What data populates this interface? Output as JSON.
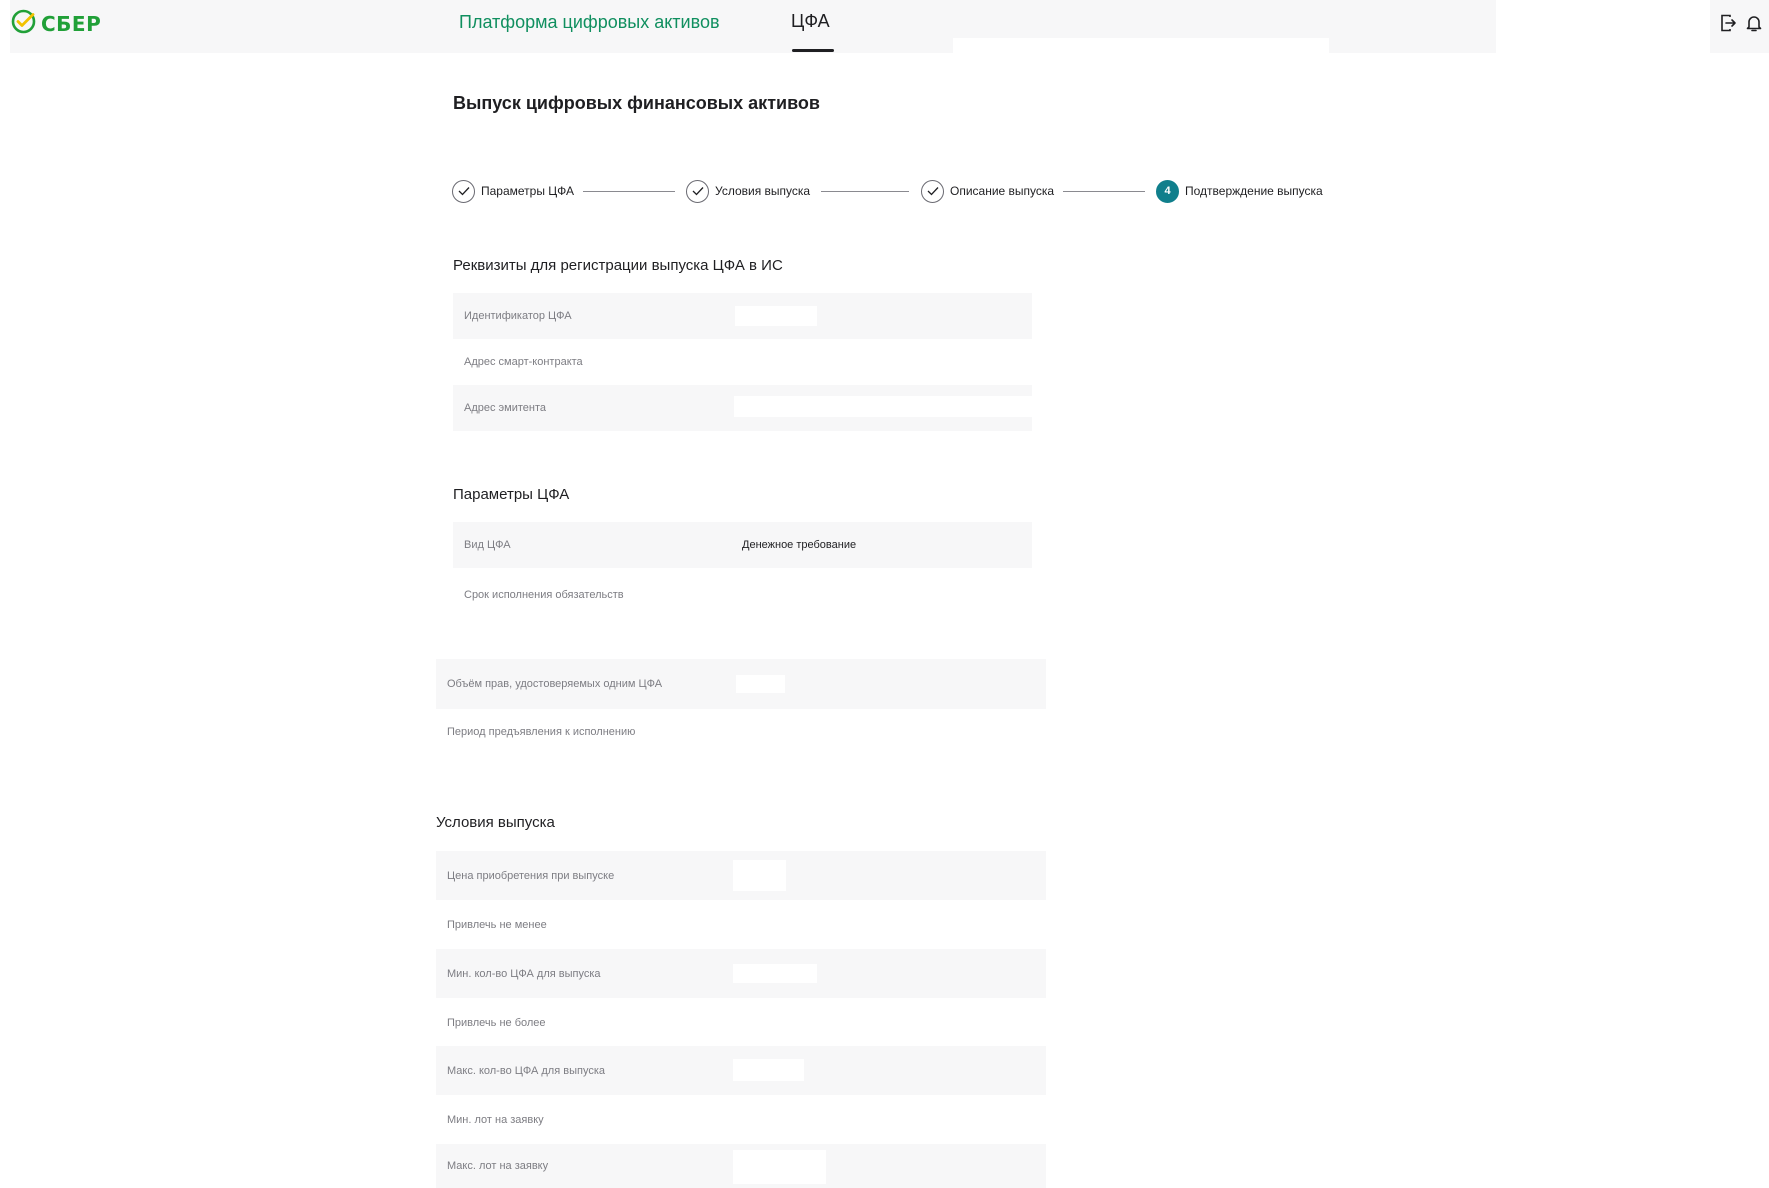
{
  "header": {
    "logo_text": "СБЕР",
    "platform_link": "Платформа цифровых активов",
    "nav_tab": "ЦФА",
    "icons": [
      "logout-icon",
      "bell-icon"
    ]
  },
  "colors": {
    "brand_green": "#21a038",
    "link_green": "#108f5f",
    "step_active": "#107f8c",
    "row_shade": "#f7f7f8"
  },
  "page": {
    "title": "Выпуск цифровых финансовых активов"
  },
  "stepper": {
    "steps": [
      {
        "label": "Параметры ЦФА",
        "state": "done"
      },
      {
        "label": "Условия выпуска",
        "state": "done"
      },
      {
        "label": "Описание выпуска",
        "state": "done"
      },
      {
        "label": "Подтверждение выпуска",
        "state": "active",
        "number": "4"
      }
    ]
  },
  "requisites": {
    "title": "Реквизиты для регистрации выпуска ЦФА в ИС",
    "rows": [
      {
        "label": "Идентификатор ЦФА",
        "value": ""
      },
      {
        "label": "Адрес смарт-контракта",
        "value": ""
      },
      {
        "label": "Адрес эмитента",
        "value": ""
      }
    ]
  },
  "params": {
    "title": "Параметры ЦФА",
    "rows": [
      {
        "label": "Вид ЦФА",
        "value": "Денежное требование"
      },
      {
        "label": "Срок исполнения обязательств",
        "value": ""
      },
      {
        "label": "Объём прав, удостоверяемых одним ЦФА",
        "value": ""
      },
      {
        "label": "Период предъявления к исполнению",
        "value": ""
      }
    ]
  },
  "conditions": {
    "title": "Условия выпуска",
    "rows": [
      {
        "label": "Цена приобретения при выпуске",
        "value": ""
      },
      {
        "label": "Привлечь не менее",
        "value": ""
      },
      {
        "label": "Мин. кол-во ЦФА для выпуска",
        "value": ""
      },
      {
        "label": "Привлечь не более",
        "value": ""
      },
      {
        "label": "Макс. кол-во ЦФА для выпуска",
        "value": ""
      },
      {
        "label": "Мин. лот на заявку",
        "value": ""
      },
      {
        "label": "Макс. лот на заявку",
        "value": ""
      }
    ]
  }
}
